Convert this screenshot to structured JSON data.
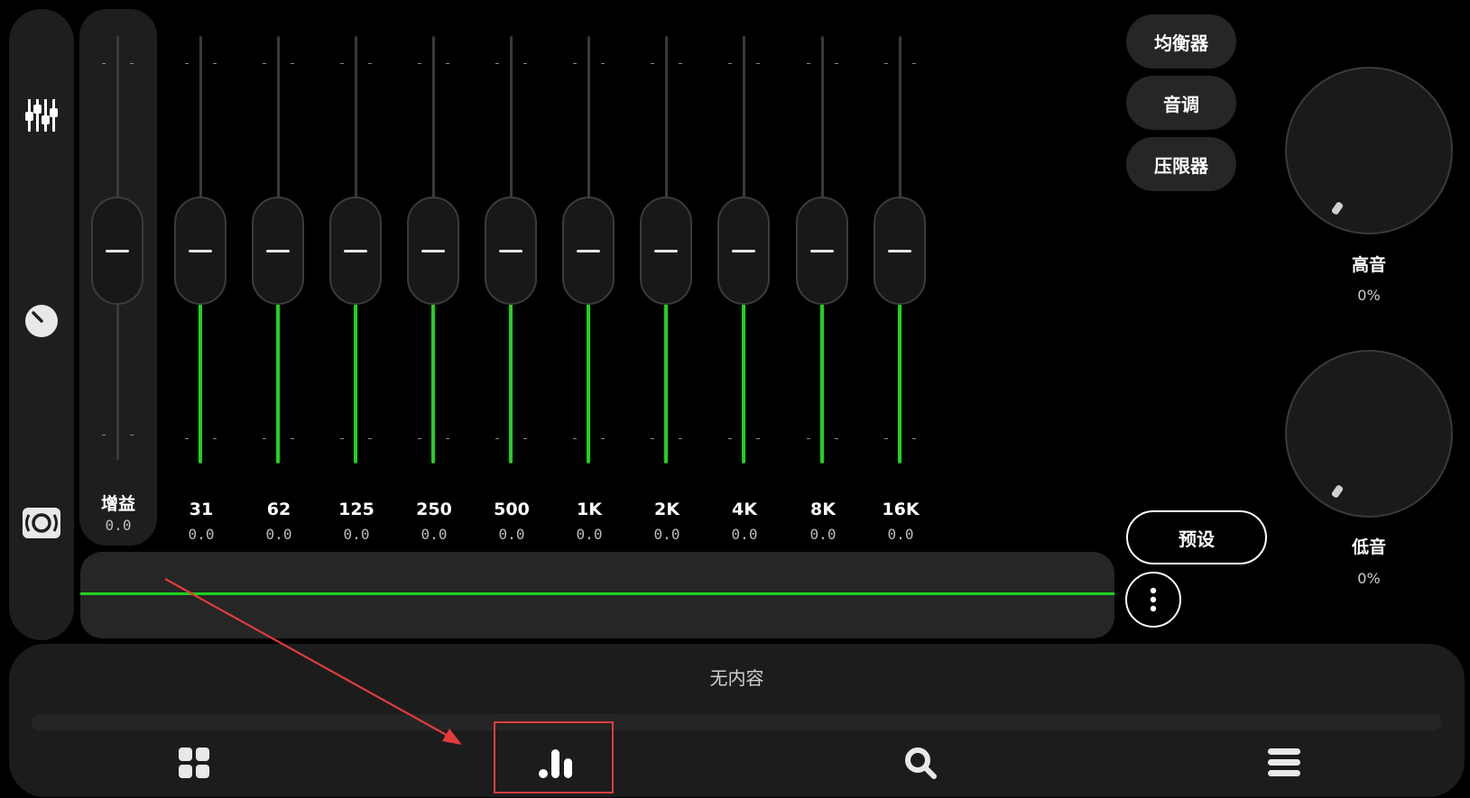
{
  "sidebar": {
    "items": [
      {
        "icon": "equalizer-sliders-icon"
      },
      {
        "icon": "knob-icon"
      },
      {
        "icon": "surround-speaker-icon"
      }
    ]
  },
  "gain": {
    "label": "增益",
    "value": "0.0"
  },
  "bands": [
    {
      "label": "31",
      "value": "0.0"
    },
    {
      "label": "62",
      "value": "0.0"
    },
    {
      "label": "125",
      "value": "0.0"
    },
    {
      "label": "250",
      "value": "0.0"
    },
    {
      "label": "500",
      "value": "0.0"
    },
    {
      "label": "1K",
      "value": "0.0"
    },
    {
      "label": "2K",
      "value": "0.0"
    },
    {
      "label": "4K",
      "value": "0.0"
    },
    {
      "label": "8K",
      "value": "0.0"
    },
    {
      "label": "16K",
      "value": "0.0"
    }
  ],
  "mode_buttons": {
    "equalizer": "均衡器",
    "tone": "音调",
    "limiter": "压限器"
  },
  "preset_label": "预设",
  "dials": {
    "treble": {
      "label": "高音",
      "value": "0%"
    },
    "bass": {
      "label": "低音",
      "value": "0%"
    }
  },
  "player": {
    "now_playing": "无内容"
  },
  "nav": {
    "items": [
      {
        "icon": "grid-icon"
      },
      {
        "icon": "bar-chart-icon"
      },
      {
        "icon": "search-icon"
      },
      {
        "icon": "menu-icon"
      }
    ]
  },
  "colors": {
    "accent": "#1fd21f",
    "highlight": "#e23b3b"
  }
}
